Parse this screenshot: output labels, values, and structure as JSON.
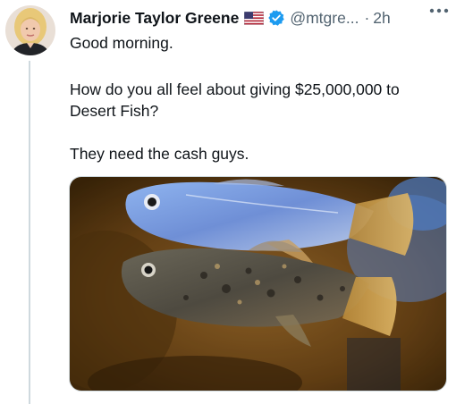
{
  "tweet": {
    "author": {
      "display_name": "Marjorie Taylor Greene",
      "handle": "@mtgre...",
      "flag_icon": "us-flag-icon",
      "verified_icon": "verified-badge-icon",
      "avatar_icon": "avatar"
    },
    "timestamp_sep": "·",
    "timestamp": "2h",
    "more_icon": "more-options-icon",
    "text": {
      "line1": "Good morning.",
      "line2": "How do you all feel about giving $25,000,000 to Desert Fish?",
      "line3": "They need the cash guys."
    },
    "media_icon": "fish-photo",
    "colors": {
      "verified": "#1d9bf0",
      "secondary_text": "#536471",
      "thread_line": "#cfd9de"
    }
  }
}
